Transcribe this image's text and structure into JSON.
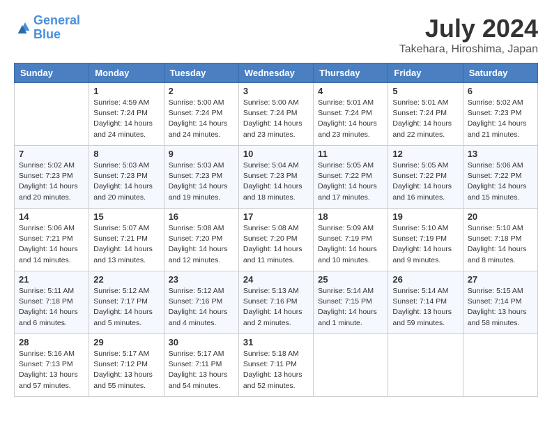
{
  "header": {
    "logo_line1": "General",
    "logo_line2": "Blue",
    "month": "July 2024",
    "location": "Takehara, Hiroshima, Japan"
  },
  "days_of_week": [
    "Sunday",
    "Monday",
    "Tuesday",
    "Wednesday",
    "Thursday",
    "Friday",
    "Saturday"
  ],
  "weeks": [
    [
      {
        "day": "",
        "empty": true
      },
      {
        "day": "1",
        "sunrise": "Sunrise: 4:59 AM",
        "sunset": "Sunset: 7:24 PM",
        "daylight": "Daylight: 14 hours and 24 minutes."
      },
      {
        "day": "2",
        "sunrise": "Sunrise: 5:00 AM",
        "sunset": "Sunset: 7:24 PM",
        "daylight": "Daylight: 14 hours and 24 minutes."
      },
      {
        "day": "3",
        "sunrise": "Sunrise: 5:00 AM",
        "sunset": "Sunset: 7:24 PM",
        "daylight": "Daylight: 14 hours and 23 minutes."
      },
      {
        "day": "4",
        "sunrise": "Sunrise: 5:01 AM",
        "sunset": "Sunset: 7:24 PM",
        "daylight": "Daylight: 14 hours and 23 minutes."
      },
      {
        "day": "5",
        "sunrise": "Sunrise: 5:01 AM",
        "sunset": "Sunset: 7:24 PM",
        "daylight": "Daylight: 14 hours and 22 minutes."
      },
      {
        "day": "6",
        "sunrise": "Sunrise: 5:02 AM",
        "sunset": "Sunset: 7:23 PM",
        "daylight": "Daylight: 14 hours and 21 minutes."
      }
    ],
    [
      {
        "day": "7",
        "sunrise": "Sunrise: 5:02 AM",
        "sunset": "Sunset: 7:23 PM",
        "daylight": "Daylight: 14 hours and 20 minutes."
      },
      {
        "day": "8",
        "sunrise": "Sunrise: 5:03 AM",
        "sunset": "Sunset: 7:23 PM",
        "daylight": "Daylight: 14 hours and 20 minutes."
      },
      {
        "day": "9",
        "sunrise": "Sunrise: 5:03 AM",
        "sunset": "Sunset: 7:23 PM",
        "daylight": "Daylight: 14 hours and 19 minutes."
      },
      {
        "day": "10",
        "sunrise": "Sunrise: 5:04 AM",
        "sunset": "Sunset: 7:23 PM",
        "daylight": "Daylight: 14 hours and 18 minutes."
      },
      {
        "day": "11",
        "sunrise": "Sunrise: 5:05 AM",
        "sunset": "Sunset: 7:22 PM",
        "daylight": "Daylight: 14 hours and 17 minutes."
      },
      {
        "day": "12",
        "sunrise": "Sunrise: 5:05 AM",
        "sunset": "Sunset: 7:22 PM",
        "daylight": "Daylight: 14 hours and 16 minutes."
      },
      {
        "day": "13",
        "sunrise": "Sunrise: 5:06 AM",
        "sunset": "Sunset: 7:22 PM",
        "daylight": "Daylight: 14 hours and 15 minutes."
      }
    ],
    [
      {
        "day": "14",
        "sunrise": "Sunrise: 5:06 AM",
        "sunset": "Sunset: 7:21 PM",
        "daylight": "Daylight: 14 hours and 14 minutes."
      },
      {
        "day": "15",
        "sunrise": "Sunrise: 5:07 AM",
        "sunset": "Sunset: 7:21 PM",
        "daylight": "Daylight: 14 hours and 13 minutes."
      },
      {
        "day": "16",
        "sunrise": "Sunrise: 5:08 AM",
        "sunset": "Sunset: 7:20 PM",
        "daylight": "Daylight: 14 hours and 12 minutes."
      },
      {
        "day": "17",
        "sunrise": "Sunrise: 5:08 AM",
        "sunset": "Sunset: 7:20 PM",
        "daylight": "Daylight: 14 hours and 11 minutes."
      },
      {
        "day": "18",
        "sunrise": "Sunrise: 5:09 AM",
        "sunset": "Sunset: 7:19 PM",
        "daylight": "Daylight: 14 hours and 10 minutes."
      },
      {
        "day": "19",
        "sunrise": "Sunrise: 5:10 AM",
        "sunset": "Sunset: 7:19 PM",
        "daylight": "Daylight: 14 hours and 9 minutes."
      },
      {
        "day": "20",
        "sunrise": "Sunrise: 5:10 AM",
        "sunset": "Sunset: 7:18 PM",
        "daylight": "Daylight: 14 hours and 8 minutes."
      }
    ],
    [
      {
        "day": "21",
        "sunrise": "Sunrise: 5:11 AM",
        "sunset": "Sunset: 7:18 PM",
        "daylight": "Daylight: 14 hours and 6 minutes."
      },
      {
        "day": "22",
        "sunrise": "Sunrise: 5:12 AM",
        "sunset": "Sunset: 7:17 PM",
        "daylight": "Daylight: 14 hours and 5 minutes."
      },
      {
        "day": "23",
        "sunrise": "Sunrise: 5:12 AM",
        "sunset": "Sunset: 7:16 PM",
        "daylight": "Daylight: 14 hours and 4 minutes."
      },
      {
        "day": "24",
        "sunrise": "Sunrise: 5:13 AM",
        "sunset": "Sunset: 7:16 PM",
        "daylight": "Daylight: 14 hours and 2 minutes."
      },
      {
        "day": "25",
        "sunrise": "Sunrise: 5:14 AM",
        "sunset": "Sunset: 7:15 PM",
        "daylight": "Daylight: 14 hours and 1 minute."
      },
      {
        "day": "26",
        "sunrise": "Sunrise: 5:14 AM",
        "sunset": "Sunset: 7:14 PM",
        "daylight": "Daylight: 13 hours and 59 minutes."
      },
      {
        "day": "27",
        "sunrise": "Sunrise: 5:15 AM",
        "sunset": "Sunset: 7:14 PM",
        "daylight": "Daylight: 13 hours and 58 minutes."
      }
    ],
    [
      {
        "day": "28",
        "sunrise": "Sunrise: 5:16 AM",
        "sunset": "Sunset: 7:13 PM",
        "daylight": "Daylight: 13 hours and 57 minutes."
      },
      {
        "day": "29",
        "sunrise": "Sunrise: 5:17 AM",
        "sunset": "Sunset: 7:12 PM",
        "daylight": "Daylight: 13 hours and 55 minutes."
      },
      {
        "day": "30",
        "sunrise": "Sunrise: 5:17 AM",
        "sunset": "Sunset: 7:11 PM",
        "daylight": "Daylight: 13 hours and 54 minutes."
      },
      {
        "day": "31",
        "sunrise": "Sunrise: 5:18 AM",
        "sunset": "Sunset: 7:11 PM",
        "daylight": "Daylight: 13 hours and 52 minutes."
      },
      {
        "day": "",
        "empty": true
      },
      {
        "day": "",
        "empty": true
      },
      {
        "day": "",
        "empty": true
      }
    ]
  ]
}
